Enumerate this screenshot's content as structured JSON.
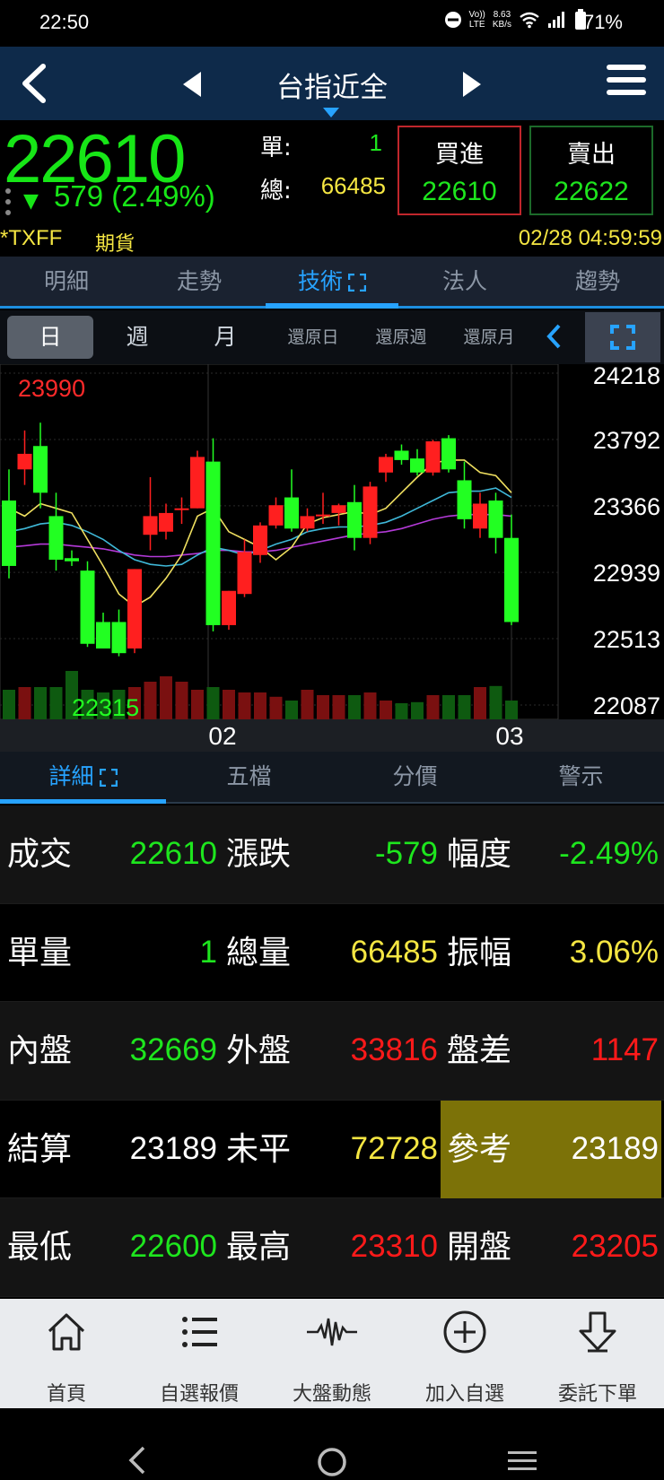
{
  "status_bar": {
    "time": "22:50",
    "net_top": "8.63",
    "net_bottom": "KB/s",
    "lte_top": "Vo))",
    "lte_bottom": "LTE",
    "battery": "71%"
  },
  "header": {
    "title": "台指近全"
  },
  "quote": {
    "price": "22610",
    "change": "579",
    "change_pct": "(2.49%)",
    "single_label": "單:",
    "single_value": "1",
    "total_label": "總:",
    "total_value": "66485",
    "buy_label": "買進",
    "buy_price": "22610",
    "sell_label": "賣出",
    "sell_price": "22622",
    "symbol": "*TXFF",
    "type": "期貨",
    "datetime": "02/28 04:59:59"
  },
  "tabs": [
    "明細",
    "走勢",
    "技術",
    "法人",
    "趨勢"
  ],
  "active_tab": "技術",
  "periods": [
    "日",
    "週",
    "月",
    "還原日",
    "還原週",
    "還原月"
  ],
  "selected_period": "日",
  "chart_data": {
    "type": "candlestick",
    "y_ticks": [
      "24218",
      "23792",
      "23366",
      "22939",
      "22513",
      "22087"
    ],
    "ylim": [
      22087,
      24218
    ],
    "x_ticks": [
      "02",
      "03"
    ],
    "max_label": "23990",
    "min_label": "22315",
    "candles": [
      {
        "o": 23400,
        "h": 23600,
        "l": 22900,
        "c": 22980
      },
      {
        "o": 23600,
        "h": 23850,
        "l": 23500,
        "c": 23700
      },
      {
        "o": 23750,
        "h": 23900,
        "l": 23350,
        "c": 23450
      },
      {
        "o": 23300,
        "h": 23450,
        "l": 22950,
        "c": 23020
      },
      {
        "o": 23030,
        "h": 23080,
        "l": 22980,
        "c": 23010
      },
      {
        "o": 22950,
        "h": 23010,
        "l": 22460,
        "c": 22480
      },
      {
        "o": 22620,
        "h": 22680,
        "l": 22450,
        "c": 22450
      },
      {
        "o": 22620,
        "h": 22700,
        "l": 22400,
        "c": 22420
      },
      {
        "o": 22450,
        "h": 22960,
        "l": 22420,
        "c": 22960
      },
      {
        "o": 23180,
        "h": 23550,
        "l": 23080,
        "c": 23300
      },
      {
        "o": 23200,
        "h": 23380,
        "l": 23150,
        "c": 23320
      },
      {
        "o": 23350,
        "h": 23420,
        "l": 23250,
        "c": 23350
      },
      {
        "o": 23350,
        "h": 23720,
        "l": 23350,
        "c": 23680
      },
      {
        "o": 23650,
        "h": 23800,
        "l": 22560,
        "c": 22600
      },
      {
        "o": 22600,
        "h": 22820,
        "l": 22570,
        "c": 22820
      },
      {
        "o": 22800,
        "h": 23150,
        "l": 22780,
        "c": 23070
      },
      {
        "o": 23050,
        "h": 23260,
        "l": 23000,
        "c": 23240
      },
      {
        "o": 23240,
        "h": 23420,
        "l": 23220,
        "c": 23370
      },
      {
        "o": 23420,
        "h": 23600,
        "l": 23200,
        "c": 23220
      },
      {
        "o": 23220,
        "h": 23350,
        "l": 23200,
        "c": 23300
      },
      {
        "o": 23300,
        "h": 23450,
        "l": 23250,
        "c": 23310
      },
      {
        "o": 23320,
        "h": 23380,
        "l": 23240,
        "c": 23370
      },
      {
        "o": 23390,
        "h": 23500,
        "l": 23080,
        "c": 23160
      },
      {
        "o": 23160,
        "h": 23520,
        "l": 23120,
        "c": 23490
      },
      {
        "o": 23580,
        "h": 23700,
        "l": 23520,
        "c": 23680
      },
      {
        "o": 23720,
        "h": 23760,
        "l": 23630,
        "c": 23660
      },
      {
        "o": 23670,
        "h": 23730,
        "l": 23560,
        "c": 23580
      },
      {
        "o": 23580,
        "h": 23790,
        "l": 23560,
        "c": 23780
      },
      {
        "o": 23800,
        "h": 23820,
        "l": 23580,
        "c": 23600
      },
      {
        "o": 23530,
        "h": 23650,
        "l": 23220,
        "c": 23280
      },
      {
        "o": 23220,
        "h": 23450,
        "l": 23160,
        "c": 23380
      },
      {
        "o": 23400,
        "h": 23450,
        "l": 23060,
        "c": 23160
      },
      {
        "o": 23160,
        "h": 23310,
        "l": 22600,
        "c": 22620
      }
    ],
    "volumes": [
      0.55,
      0.6,
      0.6,
      0.6,
      0.9,
      0.55,
      0.5,
      0.55,
      0.6,
      0.7,
      0.8,
      0.7,
      0.55,
      0.6,
      0.55,
      0.5,
      0.5,
      0.42,
      0.35,
      0.55,
      0.45,
      0.45,
      0.45,
      0.5,
      0.35,
      0.3,
      0.32,
      0.45,
      0.45,
      0.45,
      0.6,
      0.62,
      0.35
    ],
    "ma5": [
      23350,
      23300,
      23380,
      23350,
      23320,
      23150,
      22980,
      22800,
      22720,
      22780,
      22900,
      23050,
      23300,
      23350,
      23200,
      23150,
      23100,
      23020,
      23100,
      23250,
      23290,
      23310,
      23330,
      23310,
      23350,
      23450,
      23550,
      23640,
      23660,
      23660,
      23580,
      23560,
      23450
    ],
    "ma10": [
      23200,
      23220,
      23250,
      23260,
      23240,
      23200,
      23150,
      23080,
      23020,
      22990,
      22980,
      22990,
      23050,
      23100,
      23080,
      23050,
      23080,
      23120,
      23150,
      23200,
      23220,
      23230,
      23230,
      23240,
      23260,
      23300,
      23350,
      23400,
      23450,
      23460,
      23460,
      23480,
      23420
    ],
    "ma20": [
      23100,
      23110,
      23120,
      23120,
      23110,
      23100,
      23090,
      23070,
      23050,
      23040,
      23040,
      23050,
      23060,
      23080,
      23080,
      23070,
      23070,
      23080,
      23100,
      23120,
      23140,
      23160,
      23180,
      23190,
      23200,
      23220,
      23250,
      23280,
      23300,
      23310,
      23310,
      23310,
      23300
    ],
    "colors": {
      "up": "#ff1f1f",
      "down": "#22ff22",
      "ma5": "#f0e060",
      "ma10": "#3fb8d8",
      "ma20": "#b43ad8",
      "vol_up": "#7a1010",
      "vol_down": "#0e5a10"
    }
  },
  "subtabs": [
    "詳細",
    "五檔",
    "分價",
    "警示"
  ],
  "active_subtab": "詳細",
  "details": [
    [
      {
        "label": "成交",
        "value": "22610",
        "color": "green"
      },
      {
        "label": "漲跌",
        "value": "-579",
        "color": "green"
      },
      {
        "label": "幅度",
        "value": "-2.49%",
        "color": "green"
      }
    ],
    [
      {
        "label": "單量",
        "value": "1",
        "color": "green"
      },
      {
        "label": "總量",
        "value": "66485",
        "color": "yellow"
      },
      {
        "label": "振幅",
        "value": "3.06%",
        "color": "yellow"
      }
    ],
    [
      {
        "label": "內盤",
        "value": "32669",
        "color": "green"
      },
      {
        "label": "外盤",
        "value": "33816",
        "color": "red"
      },
      {
        "label": "盤差",
        "value": "1147",
        "color": "red"
      }
    ],
    [
      {
        "label": "結算",
        "value": "23189",
        "color": "white"
      },
      {
        "label": "未平",
        "value": "72728",
        "color": "yellow"
      },
      {
        "label": "參考",
        "value": "23189",
        "color": "white"
      }
    ],
    [
      {
        "label": "最低",
        "value": "22600",
        "color": "green"
      },
      {
        "label": "最高",
        "value": "23310",
        "color": "red"
      },
      {
        "label": "開盤",
        "value": "23205",
        "color": "red"
      }
    ]
  ],
  "bottom_nav": [
    {
      "label": "首頁",
      "icon": "home-icon"
    },
    {
      "label": "自選報價",
      "icon": "list-icon"
    },
    {
      "label": "大盤動態",
      "icon": "pulse-icon"
    },
    {
      "label": "加入自選",
      "icon": "add-circle-icon"
    },
    {
      "label": "委託下單",
      "icon": "order-icon"
    }
  ]
}
